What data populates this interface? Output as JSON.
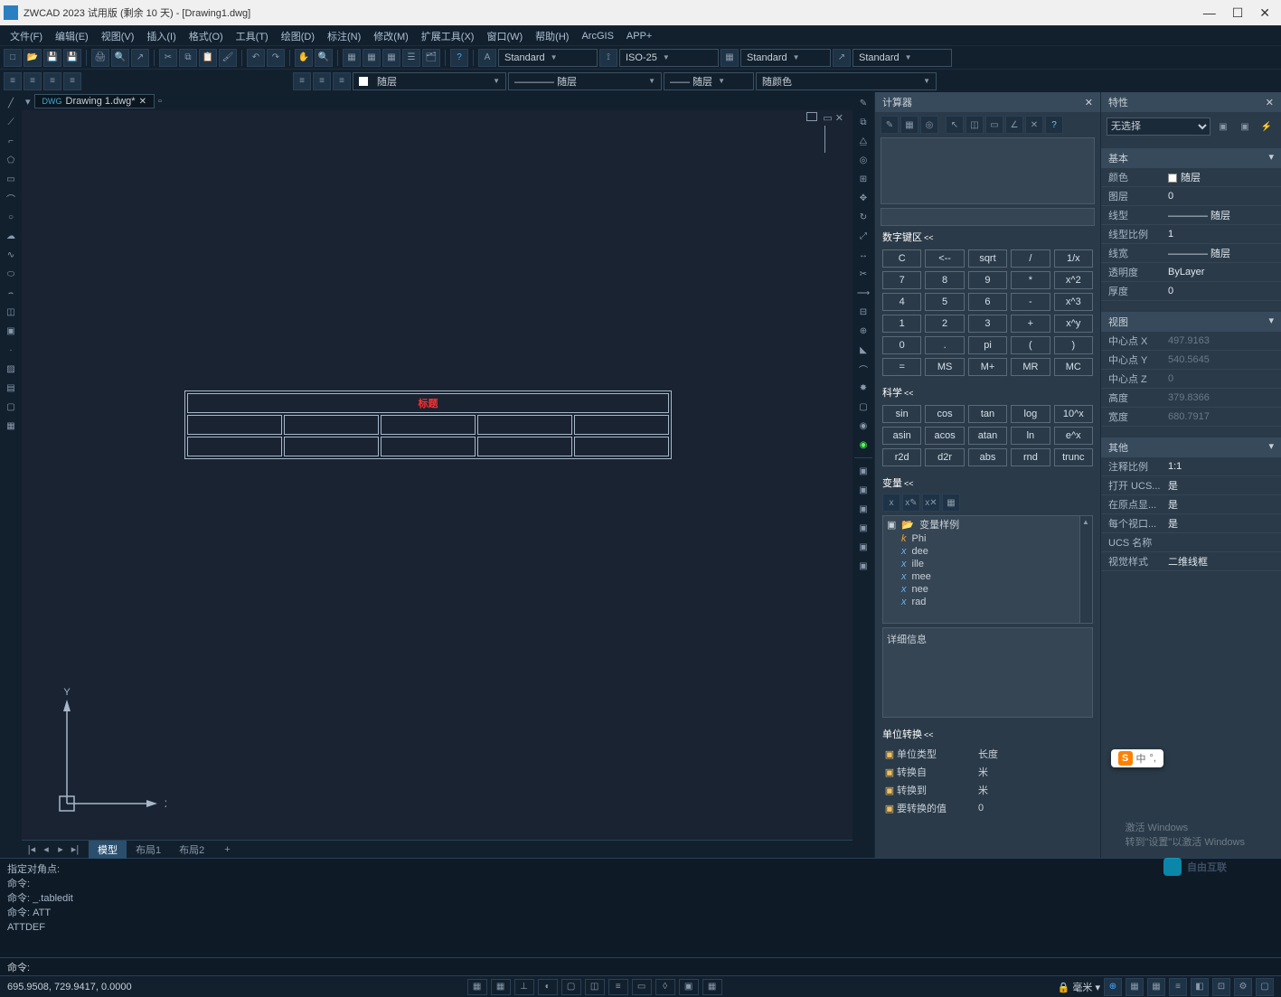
{
  "title": "ZWCAD 2023 试用版 (剩余 10 天) - [Drawing1.dwg]",
  "menu": [
    "文件(F)",
    "编辑(E)",
    "视图(V)",
    "插入(I)",
    "格式(O)",
    "工具(T)",
    "绘图(D)",
    "标注(N)",
    "修改(M)",
    "扩展工具(X)",
    "窗口(W)",
    "帮助(H)",
    "ArcGIS",
    "APP+"
  ],
  "style_dropdowns": {
    "text": "Standard",
    "dim": "ISO-25",
    "table": "Standard",
    "mleader": "Standard"
  },
  "layerbar": {
    "layer": "随层",
    "ltype": "随层",
    "lweight": "随层",
    "color": "随颜色"
  },
  "file_tab": "Drawing 1.dwg*",
  "table_title": "标题",
  "view_marker": "▬ □ ✕",
  "ucs": {
    "x": "X",
    "y": "Y"
  },
  "layouts": {
    "tabs": [
      "模型",
      "布局1",
      "布局2"
    ],
    "add": "+"
  },
  "command": {
    "lines": [
      "指定对角点:",
      "命令:",
      "命令: _.tabledit",
      "命令: ATT",
      "ATTDEF"
    ],
    "prompt": "命令:"
  },
  "calc": {
    "title": "计算器",
    "num_header": "数字键区",
    "num_keys": [
      "C",
      "<--",
      "sqrt",
      "/",
      "1/x",
      "7",
      "8",
      "9",
      "*",
      "x^2",
      "4",
      "5",
      "6",
      "-",
      "x^3",
      "1",
      "2",
      "3",
      "+",
      "x^y",
      "0",
      ".",
      "pi",
      "(",
      ")",
      "=",
      "MS",
      "M+",
      "MR",
      "MC"
    ],
    "sci_header": "科学",
    "sci_keys": [
      "sin",
      "cos",
      "tan",
      "log",
      "10^x",
      "asin",
      "acos",
      "atan",
      "ln",
      "e^x",
      "r2d",
      "d2r",
      "abs",
      "rnd",
      "trunc"
    ],
    "var_header": "变量",
    "var_root": "变量样例",
    "vars": [
      [
        "k",
        "Phi"
      ],
      [
        "x",
        "dee"
      ],
      [
        "x",
        "ille"
      ],
      [
        "x",
        "mee"
      ],
      [
        "x",
        "nee"
      ],
      [
        "x",
        "rad"
      ]
    ],
    "detail_label": "详细信息",
    "unit_header": "单位转换",
    "unit_rows": [
      [
        "单位类型",
        "长度"
      ],
      [
        "转换自",
        "米"
      ],
      [
        "转换到",
        "米"
      ],
      [
        "要转换的值",
        "0"
      ]
    ]
  },
  "props": {
    "title": "特性",
    "selector": "无选择",
    "groups": [
      {
        "name": "基本",
        "rows": [
          [
            "颜色",
            "■ 随层",
            false
          ],
          [
            "图层",
            "0",
            false
          ],
          [
            "线型",
            "———— 随层",
            false
          ],
          [
            "线型比例",
            "1",
            false
          ],
          [
            "线宽",
            "———— 随层",
            false
          ],
          [
            "透明度",
            "ByLayer",
            false
          ],
          [
            "厚度",
            "0",
            false
          ]
        ]
      },
      {
        "name": "视图",
        "rows": [
          [
            "中心点 X",
            "497.9163",
            true
          ],
          [
            "中心点 Y",
            "540.5645",
            true
          ],
          [
            "中心点 Z",
            "0",
            true
          ],
          [
            "高度",
            "379.8366",
            true
          ],
          [
            "宽度",
            "680.7917",
            true
          ]
        ]
      },
      {
        "name": "其他",
        "rows": [
          [
            "注释比例",
            "1:1",
            false
          ],
          [
            "打开 UCS...",
            "是",
            false
          ],
          [
            "在原点显...",
            "是",
            false
          ],
          [
            "每个视口...",
            "是",
            false
          ],
          [
            "UCS 名称",
            "",
            false
          ],
          [
            "视觉样式",
            "二维线框",
            false
          ]
        ]
      }
    ]
  },
  "status": {
    "coords": "695.9508, 729.9417, 0.0000",
    "right": "毫米 ▾"
  },
  "activate": {
    "line1": "激活 Windows",
    "line2": "转到\"设置\"以激活 Windows"
  },
  "watermark": "自由互联",
  "ime": "中"
}
